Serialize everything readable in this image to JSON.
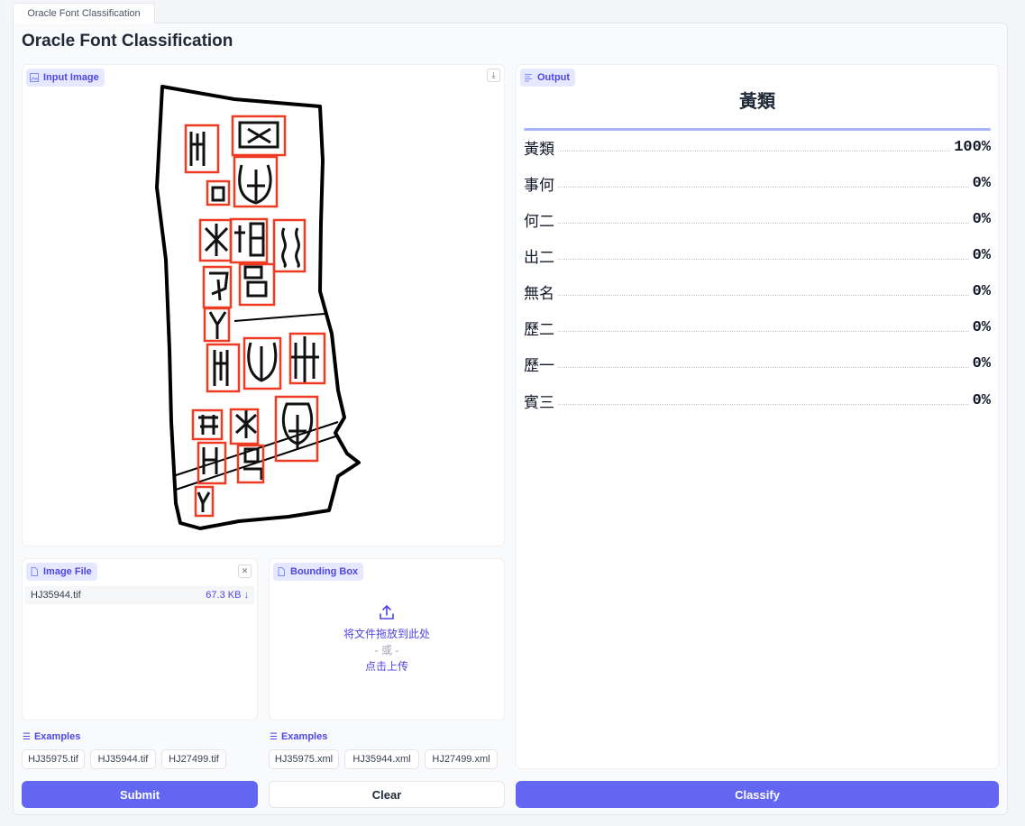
{
  "tab": {
    "label": "Oracle Font Classification"
  },
  "page": {
    "title": "Oracle Font Classification"
  },
  "input_image": {
    "label": "Input Image"
  },
  "image_file": {
    "label": "Image File",
    "file_name": "HJ35944.tif",
    "file_size": "67.3 KB ↓"
  },
  "bounding_box": {
    "label": "Bounding Box",
    "drop_text": "将文件拖放到此处",
    "or_text": "- 或 -",
    "click_text": "点击上传"
  },
  "image_examples": {
    "heading": "Examples",
    "items": [
      "HJ35975.tif",
      "HJ35944.tif",
      "HJ27499.tif"
    ]
  },
  "box_examples": {
    "heading": "Examples",
    "items": [
      "HJ35975.xml",
      "HJ35944.xml",
      "HJ27499.xml"
    ]
  },
  "buttons": {
    "submit": "Submit",
    "clear": "Clear",
    "classify": "Classify"
  },
  "output": {
    "label": "Output",
    "top_label": "黃類",
    "rows": [
      {
        "label": "黃類",
        "value": "100%"
      },
      {
        "label": "事何",
        "value": "0%"
      },
      {
        "label": "何二",
        "value": "0%"
      },
      {
        "label": "出二",
        "value": "0%"
      },
      {
        "label": "無名",
        "value": "0%"
      },
      {
        "label": "歷二",
        "value": "0%"
      },
      {
        "label": "歷一",
        "value": "0%"
      },
      {
        "label": "賓三",
        "value": "0%"
      }
    ]
  },
  "colors": {
    "accent": "#6366f1",
    "box": "#ef3b24"
  }
}
